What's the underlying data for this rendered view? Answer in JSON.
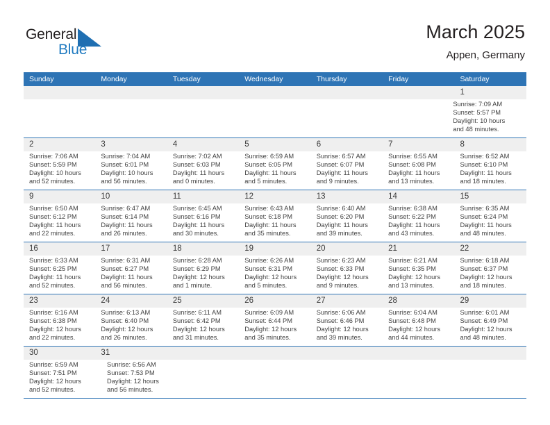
{
  "brand": {
    "name_part1": "General",
    "name_part2": "Blue",
    "accent_color": "#1f7ac0"
  },
  "header": {
    "title": "March 2025",
    "location": "Appen, Germany"
  },
  "theme": {
    "header_blue": "#2e74b5",
    "daynum_band": "#efefef",
    "text": "#404040"
  },
  "weekdays": [
    "Sunday",
    "Monday",
    "Tuesday",
    "Wednesday",
    "Thursday",
    "Friday",
    "Saturday"
  ],
  "weeks": [
    {
      "days": [
        {
          "num": "",
          "lines": []
        },
        {
          "num": "",
          "lines": []
        },
        {
          "num": "",
          "lines": []
        },
        {
          "num": "",
          "lines": []
        },
        {
          "num": "",
          "lines": []
        },
        {
          "num": "",
          "lines": []
        },
        {
          "num": "1",
          "lines": [
            "Sunrise: 7:09 AM",
            "Sunset: 5:57 PM",
            "Daylight: 10 hours",
            "and 48 minutes."
          ]
        }
      ]
    },
    {
      "days": [
        {
          "num": "2",
          "lines": [
            "Sunrise: 7:06 AM",
            "Sunset: 5:59 PM",
            "Daylight: 10 hours",
            "and 52 minutes."
          ]
        },
        {
          "num": "3",
          "lines": [
            "Sunrise: 7:04 AM",
            "Sunset: 6:01 PM",
            "Daylight: 10 hours",
            "and 56 minutes."
          ]
        },
        {
          "num": "4",
          "lines": [
            "Sunrise: 7:02 AM",
            "Sunset: 6:03 PM",
            "Daylight: 11 hours",
            "and 0 minutes."
          ]
        },
        {
          "num": "5",
          "lines": [
            "Sunrise: 6:59 AM",
            "Sunset: 6:05 PM",
            "Daylight: 11 hours",
            "and 5 minutes."
          ]
        },
        {
          "num": "6",
          "lines": [
            "Sunrise: 6:57 AM",
            "Sunset: 6:07 PM",
            "Daylight: 11 hours",
            "and 9 minutes."
          ]
        },
        {
          "num": "7",
          "lines": [
            "Sunrise: 6:55 AM",
            "Sunset: 6:08 PM",
            "Daylight: 11 hours",
            "and 13 minutes."
          ]
        },
        {
          "num": "8",
          "lines": [
            "Sunrise: 6:52 AM",
            "Sunset: 6:10 PM",
            "Daylight: 11 hours",
            "and 18 minutes."
          ]
        }
      ]
    },
    {
      "days": [
        {
          "num": "9",
          "lines": [
            "Sunrise: 6:50 AM",
            "Sunset: 6:12 PM",
            "Daylight: 11 hours",
            "and 22 minutes."
          ]
        },
        {
          "num": "10",
          "lines": [
            "Sunrise: 6:47 AM",
            "Sunset: 6:14 PM",
            "Daylight: 11 hours",
            "and 26 minutes."
          ]
        },
        {
          "num": "11",
          "lines": [
            "Sunrise: 6:45 AM",
            "Sunset: 6:16 PM",
            "Daylight: 11 hours",
            "and 30 minutes."
          ]
        },
        {
          "num": "12",
          "lines": [
            "Sunrise: 6:43 AM",
            "Sunset: 6:18 PM",
            "Daylight: 11 hours",
            "and 35 minutes."
          ]
        },
        {
          "num": "13",
          "lines": [
            "Sunrise: 6:40 AM",
            "Sunset: 6:20 PM",
            "Daylight: 11 hours",
            "and 39 minutes."
          ]
        },
        {
          "num": "14",
          "lines": [
            "Sunrise: 6:38 AM",
            "Sunset: 6:22 PM",
            "Daylight: 11 hours",
            "and 43 minutes."
          ]
        },
        {
          "num": "15",
          "lines": [
            "Sunrise: 6:35 AM",
            "Sunset: 6:24 PM",
            "Daylight: 11 hours",
            "and 48 minutes."
          ]
        }
      ]
    },
    {
      "days": [
        {
          "num": "16",
          "lines": [
            "Sunrise: 6:33 AM",
            "Sunset: 6:25 PM",
            "Daylight: 11 hours",
            "and 52 minutes."
          ]
        },
        {
          "num": "17",
          "lines": [
            "Sunrise: 6:31 AM",
            "Sunset: 6:27 PM",
            "Daylight: 11 hours",
            "and 56 minutes."
          ]
        },
        {
          "num": "18",
          "lines": [
            "Sunrise: 6:28 AM",
            "Sunset: 6:29 PM",
            "Daylight: 12 hours",
            "and 1 minute."
          ]
        },
        {
          "num": "19",
          "lines": [
            "Sunrise: 6:26 AM",
            "Sunset: 6:31 PM",
            "Daylight: 12 hours",
            "and 5 minutes."
          ]
        },
        {
          "num": "20",
          "lines": [
            "Sunrise: 6:23 AM",
            "Sunset: 6:33 PM",
            "Daylight: 12 hours",
            "and 9 minutes."
          ]
        },
        {
          "num": "21",
          "lines": [
            "Sunrise: 6:21 AM",
            "Sunset: 6:35 PM",
            "Daylight: 12 hours",
            "and 13 minutes."
          ]
        },
        {
          "num": "22",
          "lines": [
            "Sunrise: 6:18 AM",
            "Sunset: 6:37 PM",
            "Daylight: 12 hours",
            "and 18 minutes."
          ]
        }
      ]
    },
    {
      "days": [
        {
          "num": "23",
          "lines": [
            "Sunrise: 6:16 AM",
            "Sunset: 6:38 PM",
            "Daylight: 12 hours",
            "and 22 minutes."
          ]
        },
        {
          "num": "24",
          "lines": [
            "Sunrise: 6:13 AM",
            "Sunset: 6:40 PM",
            "Daylight: 12 hours",
            "and 26 minutes."
          ]
        },
        {
          "num": "25",
          "lines": [
            "Sunrise: 6:11 AM",
            "Sunset: 6:42 PM",
            "Daylight: 12 hours",
            "and 31 minutes."
          ]
        },
        {
          "num": "26",
          "lines": [
            "Sunrise: 6:09 AM",
            "Sunset: 6:44 PM",
            "Daylight: 12 hours",
            "and 35 minutes."
          ]
        },
        {
          "num": "27",
          "lines": [
            "Sunrise: 6:06 AM",
            "Sunset: 6:46 PM",
            "Daylight: 12 hours",
            "and 39 minutes."
          ]
        },
        {
          "num": "28",
          "lines": [
            "Sunrise: 6:04 AM",
            "Sunset: 6:48 PM",
            "Daylight: 12 hours",
            "and 44 minutes."
          ]
        },
        {
          "num": "29",
          "lines": [
            "Sunrise: 6:01 AM",
            "Sunset: 6:49 PM",
            "Daylight: 12 hours",
            "and 48 minutes."
          ]
        }
      ]
    },
    {
      "days": [
        {
          "num": "30",
          "lines": [
            "Sunrise: 6:59 AM",
            "Sunset: 7:51 PM",
            "Daylight: 12 hours",
            "and 52 minutes."
          ]
        },
        {
          "num": "31",
          "lines": [
            "Sunrise: 6:56 AM",
            "Sunset: 7:53 PM",
            "Daylight: 12 hours",
            "and 56 minutes."
          ]
        },
        {
          "num": "",
          "lines": []
        },
        {
          "num": "",
          "lines": []
        },
        {
          "num": "",
          "lines": []
        },
        {
          "num": "",
          "lines": []
        },
        {
          "num": "",
          "lines": []
        }
      ]
    }
  ]
}
